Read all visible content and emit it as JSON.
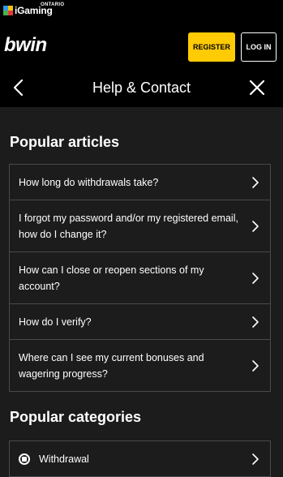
{
  "brand": {
    "igaming_text": "iGaming",
    "igaming_region": "ONTARIO",
    "logo": "bwin"
  },
  "header": {
    "register_label": "REGISTER",
    "login_label": "LOG IN"
  },
  "nav": {
    "title": "Help & Contact"
  },
  "popular_articles": {
    "title": "Popular articles",
    "items": [
      {
        "label": "How long do withdrawals take?"
      },
      {
        "label": "I forgot my password and/or my registered email, how do I change it?"
      },
      {
        "label": "How can I close or reopen sections of my account?"
      },
      {
        "label": "How do I verify?"
      },
      {
        "label": "Where can I see my current bonuses and wagering progress?"
      }
    ]
  },
  "popular_categories": {
    "title": "Popular categories",
    "items": [
      {
        "label": "Withdrawal"
      }
    ]
  },
  "colors": {
    "accent": "#ffcb05",
    "background": "#1c1c1c",
    "header_bg": "#000000",
    "border": "#4a4a4a"
  }
}
